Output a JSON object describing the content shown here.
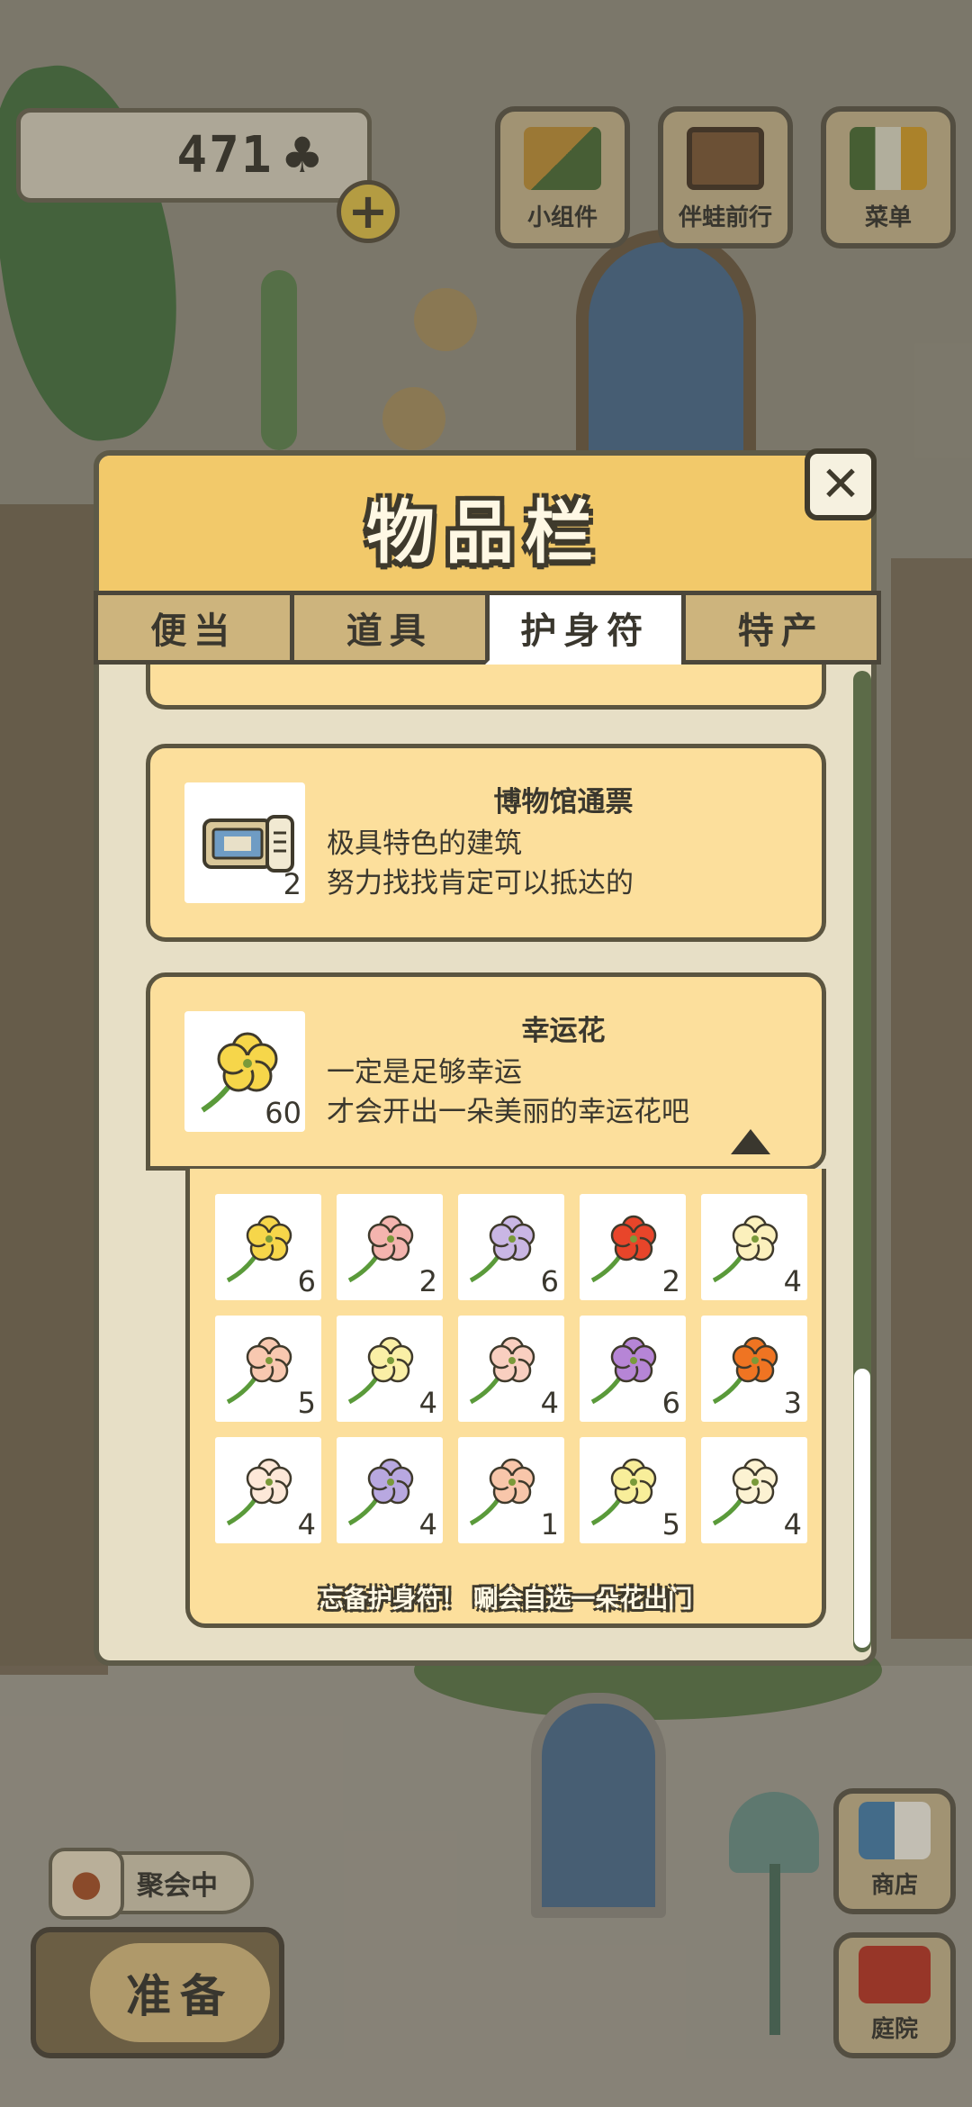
{
  "hud": {
    "clover_count": "471",
    "clover_icon": "clover-icon",
    "plus_icon": "plus-icon",
    "buttons": [
      {
        "label": "小组件",
        "icon": "widget-icon"
      },
      {
        "label": "伴蛙前行",
        "icon": "travel-book-icon"
      },
      {
        "label": "菜单",
        "icon": "menu-icon"
      }
    ]
  },
  "inventory": {
    "title": "物品栏",
    "close_icon": "close-icon",
    "tabs": [
      {
        "label": "便当",
        "active": false
      },
      {
        "label": "道具",
        "active": false
      },
      {
        "label": "护身符",
        "active": true
      },
      {
        "label": "特产",
        "active": false
      }
    ],
    "items": [
      {
        "name": "博物馆通票",
        "count": "2",
        "icon": "museum-ticket-icon",
        "desc_lines": [
          "极具特色的建筑",
          "努力找找肯定可以抵达的"
        ]
      },
      {
        "name": "幸运花",
        "count": "60",
        "icon": "lucky-flower-icon",
        "desc_lines": [
          "一定是足够幸运",
          "才会开出一朵美丽的幸运花吧"
        ],
        "expanded": true
      }
    ],
    "flowers": [
      {
        "count": "6",
        "color": "#f6d64a"
      },
      {
        "count": "2",
        "color": "#f4b4ae"
      },
      {
        "count": "6",
        "color": "#c9b6e4"
      },
      {
        "count": "2",
        "color": "#e8452a"
      },
      {
        "count": "4",
        "color": "#fbf0bc"
      },
      {
        "count": "5",
        "color": "#f8c8b0"
      },
      {
        "count": "4",
        "color": "#faefa6"
      },
      {
        "count": "4",
        "color": "#f9cfc0"
      },
      {
        "count": "6",
        "color": "#b685d6"
      },
      {
        "count": "3",
        "color": "#ef7422"
      },
      {
        "count": "4",
        "color": "#fde8d8"
      },
      {
        "count": "4",
        "color": "#b8a8e0"
      },
      {
        "count": "1",
        "color": "#f8c6aa"
      },
      {
        "count": "5",
        "color": "#f8ee9a"
      },
      {
        "count": "4",
        "color": "#fcf2d2"
      }
    ],
    "flower_note": "忘备护身符！ 唰会自选一朵花出门"
  },
  "bottom": {
    "party_label": "聚会中",
    "ready_label": "准备",
    "shop_label": "商店",
    "yard_label": "庭院"
  },
  "colors": {
    "header": "#f2c96a",
    "card": "#fcdf9c",
    "border": "#5b5540",
    "panel": "#e7dfc6"
  }
}
